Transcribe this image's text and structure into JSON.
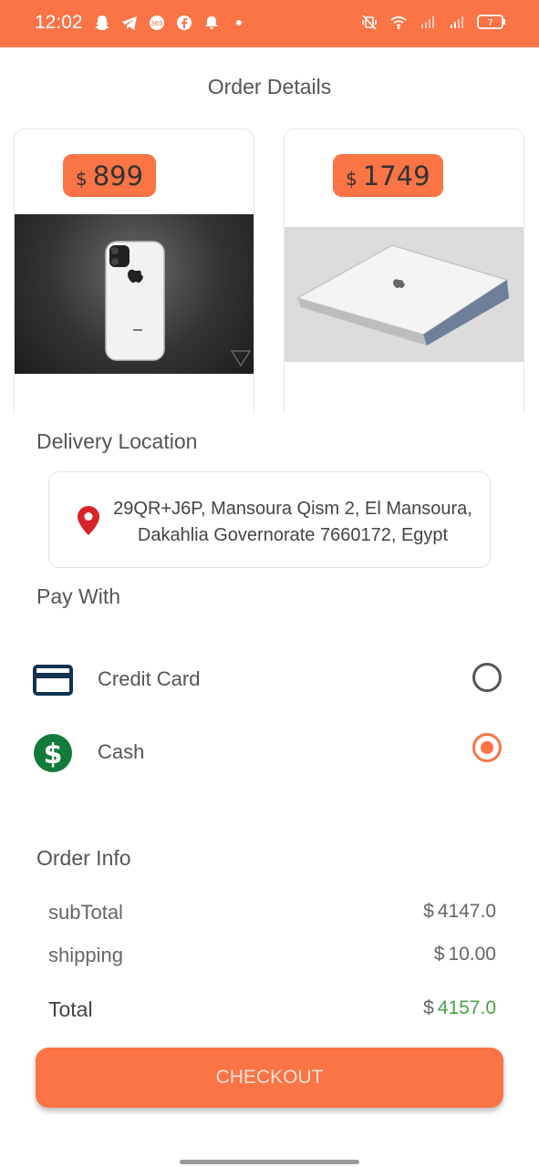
{
  "status_bar": {
    "time": "12:02",
    "notification_icons": [
      "snapchat-icon",
      "telegram-icon",
      "365-icon",
      "facebook-icon",
      "bell-icon",
      "dot-icon"
    ],
    "system_icons": [
      "mute-vibrate-icon",
      "wifi-icon",
      "signal-icon",
      "signal-icon-2",
      "battery-icon"
    ],
    "battery_level": "7",
    "background_color": "#fa7446"
  },
  "page": {
    "title": "Order Details"
  },
  "products": [
    {
      "currency": "$",
      "price": "899",
      "image": "iphone-image"
    },
    {
      "currency": "$",
      "price": "1749",
      "image": "macbook-image"
    }
  ],
  "delivery": {
    "label": "Delivery Location",
    "address_line1": "29QR+J6P, Mansoura Qism 2, El Mansoura,",
    "address_line2": "Dakahlia Governorate 7660172, Egypt",
    "icon": "location-pin-icon"
  },
  "payment": {
    "label": "Pay With",
    "options": [
      {
        "label": "Credit Card",
        "icon": "credit-card-icon",
        "selected": false
      },
      {
        "label": "Cash",
        "icon": "dollar-coin-icon",
        "selected": true
      }
    ]
  },
  "order_info": {
    "label": "Order Info",
    "subtotal_label": "subTotal",
    "subtotal_currency": "$",
    "subtotal_value": "4147.0",
    "shipping_label": "shipping",
    "shipping_currency": "$",
    "shipping_value": "10.00",
    "total_label": "Total",
    "total_currency": "$",
    "total_value": "4157.0"
  },
  "checkout": {
    "label": "CHECKOUT"
  },
  "colors": {
    "accent": "#fa7446",
    "total_green": "#4aa146",
    "card_blue": "#12334f",
    "cash_green": "#127a3a",
    "pin_red": "#d8232a"
  }
}
